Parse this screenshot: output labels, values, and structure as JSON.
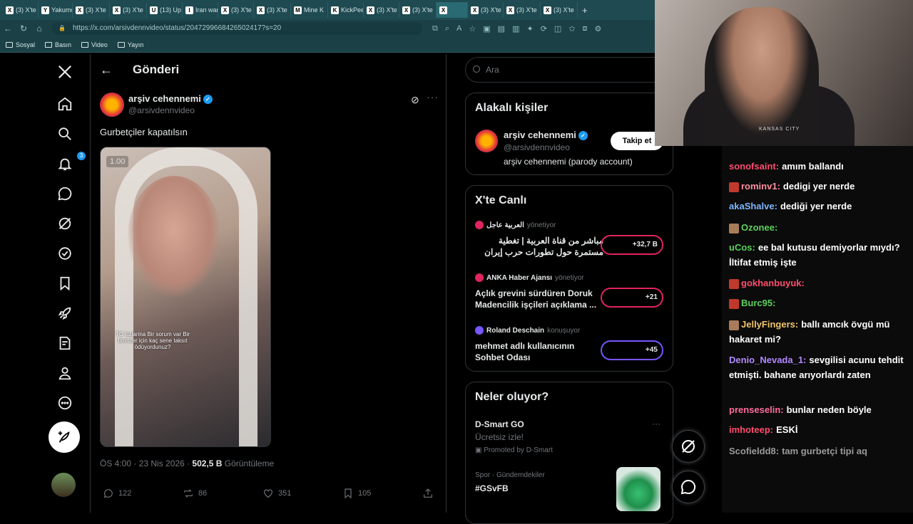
{
  "browser": {
    "tabs": [
      {
        "label": "(3) X'te",
        "favicon": "X"
      },
      {
        "label": "Yakumo",
        "favicon": "Y"
      },
      {
        "label": "(3) X'te",
        "favicon": "X"
      },
      {
        "label": "(3) X'te",
        "favicon": "X"
      },
      {
        "label": "(13) Up",
        "favicon": "U"
      },
      {
        "label": "Iran war",
        "favicon": "I"
      },
      {
        "label": "(3) X'te",
        "favicon": "X"
      },
      {
        "label": "(3) X'te",
        "favicon": "X"
      },
      {
        "label": "Mine K",
        "favicon": "M"
      },
      {
        "label": "KickPee",
        "favicon": "K"
      },
      {
        "label": "(3) X'te",
        "favicon": "X"
      },
      {
        "label": "(3) X'te",
        "favicon": "X"
      },
      {
        "label": "",
        "favicon": "X"
      },
      {
        "label": "(3) X'te",
        "favicon": "X"
      },
      {
        "label": "(3) X'te",
        "favicon": "X"
      },
      {
        "label": "(3) X'te",
        "favicon": "X"
      }
    ],
    "url": "https://x.com/arsivdennvideo/status/2047299668426502417?s=20",
    "bookmarks": [
      "Sosyal",
      "Basın",
      "Video",
      "Yayın"
    ]
  },
  "nav": {
    "notifications_badge": "3"
  },
  "header": {
    "title": "Gönderi"
  },
  "post": {
    "display_name": "arşiv cehennemi",
    "handle": "@arsivdennvideo",
    "text": "Gurbetçiler kapatılsın",
    "media_rate": "1.00",
    "media_caption": "TC kizlarina Bir sorum var Bir bronzer için kaç sene taksıt ödüyordunuz?",
    "time": "ÖS 4:00 · 23 Nis 2026 · ",
    "views_count": "502,5 B",
    "views_label": " Görüntüleme",
    "replies": "122",
    "reposts": "86",
    "likes": "351",
    "bookmarks": "105"
  },
  "search": {
    "placeholder": "Ara"
  },
  "related": {
    "title": "Alakalı kişiler",
    "name": "arşiv cehennemi",
    "handle": "@arsivdennvideo",
    "bio": "arşiv cehennemi (parody account)",
    "follow_label": "Takip et"
  },
  "live": {
    "title": "X'te Canlı",
    "items": [
      {
        "host": "العربية عاجل",
        "role": "yönetiyor",
        "title": "مباشر من قناة العربية | تغطية مستمرة حول تطورات حرب إيران",
        "count": "+32,7 B",
        "color": "#e0245e"
      },
      {
        "host": "ANKA Haber Ajansı",
        "role": "yönetiyor",
        "title": "Açlık grevini sürdüren Doruk Madencilik işçileri açıklama ...",
        "count": "+21",
        "color": "#e0245e"
      },
      {
        "host": "Roland Deschain",
        "role": "konuşuyor",
        "title": "mehmet adlı kullanıcının Sohbet Odası",
        "count": "+45",
        "color": "#7856ff"
      }
    ]
  },
  "trends": {
    "title": "Neler oluyor?",
    "promo_title": "D-Smart GO",
    "promo_sub": "Ücretsiz izle!",
    "promo_by": "Promoted by D-Smart",
    "category": "Spor · Gündemdekiler",
    "tag": "#GSvFB"
  },
  "webcam": {
    "shirt_text": "KANSAS CITY"
  },
  "chat": [
    {
      "user": "sonofsaint:",
      "color": "#ff4d6d",
      "msg": "amım ballandı",
      "emote": ""
    },
    {
      "user": "rominv1:",
      "color": "#ff8fa0",
      "msg": "dedigi yer nerde",
      "emote": "#c0392b"
    },
    {
      "user": "akaShalve:",
      "color": "#7fb6ff",
      "msg": "dediği yer nerde",
      "emote": ""
    },
    {
      "user": "Ozonee:",
      "color": "#5bd15b",
      "msg": "",
      "emote": "#a87c5a"
    },
    {
      "user": "uCos:",
      "color": "#5bd15b",
      "msg": "ee bal kutusu demiyorlar mıydı? İltifat etmiş işte",
      "emote": ""
    },
    {
      "user": "gokhanbuyuk:",
      "color": "#ff4d6d",
      "msg": "",
      "emote": "#c0392b"
    },
    {
      "user": "Burc95:",
      "color": "#5bd15b",
      "msg": "",
      "emote": "#c0392b"
    },
    {
      "user": "JellyFingers:",
      "color": "#f0c36b",
      "msg": "ballı amcık övgü mü hakaret mi?",
      "emote": "#a87c5a"
    },
    {
      "user": "Denio_Nevada_1:",
      "color": "#b388ff",
      "msg": "sevgilisi acunu tehdit etmişti. bahane arıyorlardı zaten",
      "emote": ""
    },
    {
      "user": "prenseselin:",
      "color": "#ff6b9d",
      "msg": "bunlar neden böyle",
      "emote": ""
    },
    {
      "user": "imhoteep:",
      "color": "#ff4d6d",
      "msg": "ESKİ",
      "emote": ""
    },
    {
      "user": "Scofieldd8:",
      "color": "#9a9a9a",
      "msg": "tam gurbetçi tipi aq",
      "emote": ""
    }
  ]
}
